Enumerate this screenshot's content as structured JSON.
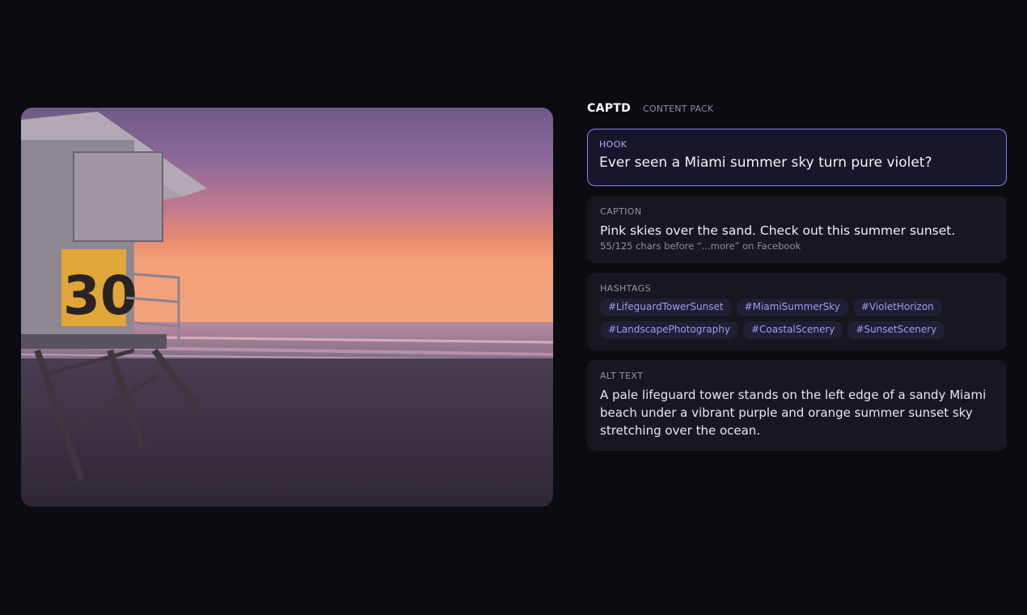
{
  "photo": {
    "alt": "Lifeguard tower on a beach at sunset",
    "tower_number": "30"
  },
  "panel": {
    "brand": "CAPTD",
    "subtitle": "CONTENT PACK",
    "hook": {
      "label": "HOOK",
      "text": "Ever seen a Miami summer sky turn pure violet?"
    },
    "caption": {
      "label": "CAPTION",
      "text": "Pink skies over the sand. Check out this summer sunset.",
      "meta": "55/125 chars before “...more” on Facebook"
    },
    "hashtags": {
      "label": "HASHTAGS",
      "items": [
        "#LifeguardTowerSunset",
        "#MiamiSummerSky",
        "#VioletHorizon",
        "#LandscapePhotography",
        "#CoastalScenery",
        "#SunsetScenery"
      ]
    },
    "alt_text": {
      "label": "ALT TEXT",
      "text": "A pale lifeguard tower stands on the left edge of a sandy Miami beach under a vibrant purple and orange summer sunset sky stretching over the ocean."
    }
  },
  "colors": {
    "background": "#0b0c12",
    "card": "#16171f",
    "accent": "#8a7ff2",
    "tag_text": "#a39bf0"
  }
}
